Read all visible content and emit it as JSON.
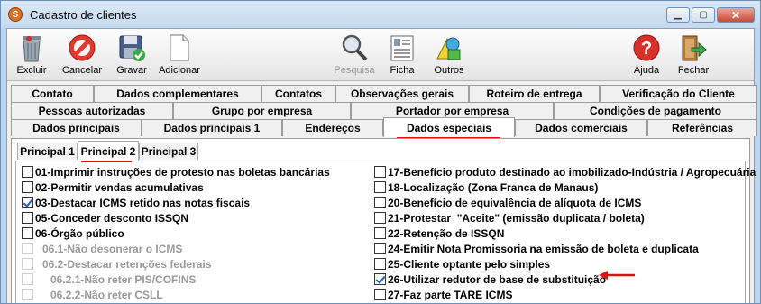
{
  "window": {
    "title": "Cadastro de clientes"
  },
  "toolbar": {
    "excluir": "Excluir",
    "cancelar": "Cancelar",
    "gravar": "Gravar",
    "adicionar": "Adicionar",
    "pesquisa": "Pesquisa",
    "ficha": "Ficha",
    "outros": "Outros",
    "ajuda": "Ajuda",
    "fechar": "Fechar"
  },
  "tabs": {
    "row1": [
      "Contato",
      "Dados complementares",
      "Contatos",
      "Observações gerais",
      "Roteiro de entrega",
      "Verificação do Cliente"
    ],
    "row2": [
      "Pessoas autorizadas",
      "Grupo por empresa",
      "Portador por empresa",
      "Condições de pagamento"
    ],
    "row3": [
      "Dados principais",
      "Dados principais 1",
      "Endereços",
      "Dados especiais",
      "Dados comerciais",
      "Referências"
    ],
    "active": "Dados especiais"
  },
  "subtabs": [
    "Principal 1",
    "Principal 2",
    "Principal 3"
  ],
  "subtab_active": "Principal 2",
  "left_options": [
    {
      "label": "01-Imprimir instruções de protesto nas boletas bancárias",
      "checked": false,
      "enabled": true
    },
    {
      "label": "02-Permitir vendas acumulativas",
      "checked": false,
      "enabled": true
    },
    {
      "label": "03-Destacar ICMS retido nas notas fiscais",
      "checked": true,
      "enabled": true
    },
    {
      "label": "05-Conceder desconto ISSQN",
      "checked": false,
      "enabled": true
    },
    {
      "label": "06-Órgão público",
      "checked": false,
      "enabled": true
    },
    {
      "label": "06.1-Não desonerar o ICMS",
      "checked": false,
      "enabled": false
    },
    {
      "label": "06.2-Destacar retenções federais",
      "checked": false,
      "enabled": false
    },
    {
      "label": "06.2.1-Não reter PIS/COFINS",
      "checked": false,
      "enabled": false
    },
    {
      "label": "06.2.2-Não reter CSLL",
      "checked": false,
      "enabled": false
    }
  ],
  "right_options": [
    {
      "label": "17-Benefício produto destinado ao imobilizado-Indústria / Agropecuária",
      "checked": false,
      "enabled": true
    },
    {
      "label": "18-Localização (Zona Franca de Manaus)",
      "checked": false,
      "enabled": true
    },
    {
      "label": "20-Benefício de equivalência de alíquota de ICMS",
      "checked": false,
      "enabled": true
    },
    {
      "label": "21-Protestar  \"Aceite\" (emissão duplicata / boleta)",
      "checked": false,
      "enabled": true
    },
    {
      "label": "22-Retenção de ISSQN",
      "checked": false,
      "enabled": true
    },
    {
      "label": "24-Emitir Nota Promissoria na emissão de boleta e duplicata",
      "checked": false,
      "enabled": true
    },
    {
      "label": "25-Cliente optante pelo simples",
      "checked": false,
      "enabled": true
    },
    {
      "label": "26-Utilizar redutor de base de substituição",
      "checked": true,
      "enabled": true
    },
    {
      "label": "27-Faz parte TARE ICMS",
      "checked": false,
      "enabled": true
    }
  ],
  "colors": {
    "accent_red": "#e01010",
    "check_blue": "#1f5fbf"
  }
}
